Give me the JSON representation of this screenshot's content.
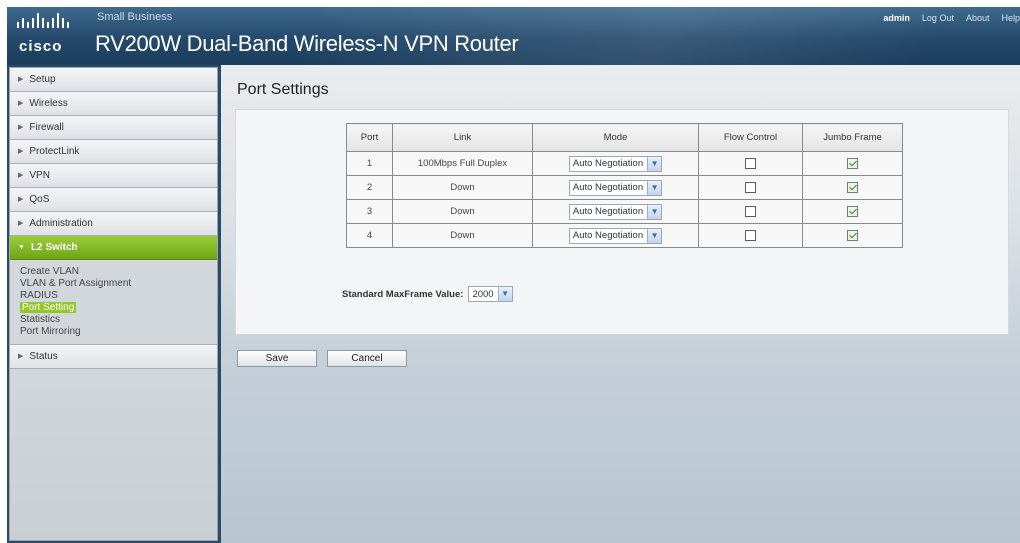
{
  "header": {
    "logo_text": "cisco",
    "brand_line": "Small Business",
    "product_title": "RV200W Dual-Band Wireless-N VPN Router",
    "user": "admin",
    "links": [
      "Log Out",
      "About",
      "Help"
    ]
  },
  "sidebar": {
    "items": [
      {
        "label": "Setup"
      },
      {
        "label": "Wireless"
      },
      {
        "label": "Firewall"
      },
      {
        "label": "ProtectLink"
      },
      {
        "label": "VPN"
      },
      {
        "label": "QoS"
      },
      {
        "label": "Administration"
      },
      {
        "label": "L2 Switch"
      },
      {
        "label": "Status"
      }
    ],
    "l2_subitems": [
      "Create VLAN",
      "VLAN & Port Assignment",
      "RADIUS",
      "Port Setting",
      "Statistics",
      "Port Mirroring"
    ]
  },
  "main": {
    "title": "Port Settings",
    "columns": [
      "Port",
      "Link",
      "Mode",
      "Flow Control",
      "Jumbo Frame"
    ],
    "rows": [
      {
        "port": "1",
        "link": "100Mbps Full Duplex",
        "mode": "Auto Negotiation",
        "flow_control": false,
        "jumbo": true
      },
      {
        "port": "2",
        "link": "Down",
        "mode": "Auto Negotiation",
        "flow_control": false,
        "jumbo": true
      },
      {
        "port": "3",
        "link": "Down",
        "mode": "Auto Negotiation",
        "flow_control": false,
        "jumbo": true
      },
      {
        "port": "4",
        "link": "Down",
        "mode": "Auto Negotiation",
        "flow_control": false,
        "jumbo": true
      }
    ],
    "maxframe_label": "Standard MaxFrame Value:",
    "maxframe_value": "2000",
    "save_label": "Save",
    "cancel_label": "Cancel"
  }
}
